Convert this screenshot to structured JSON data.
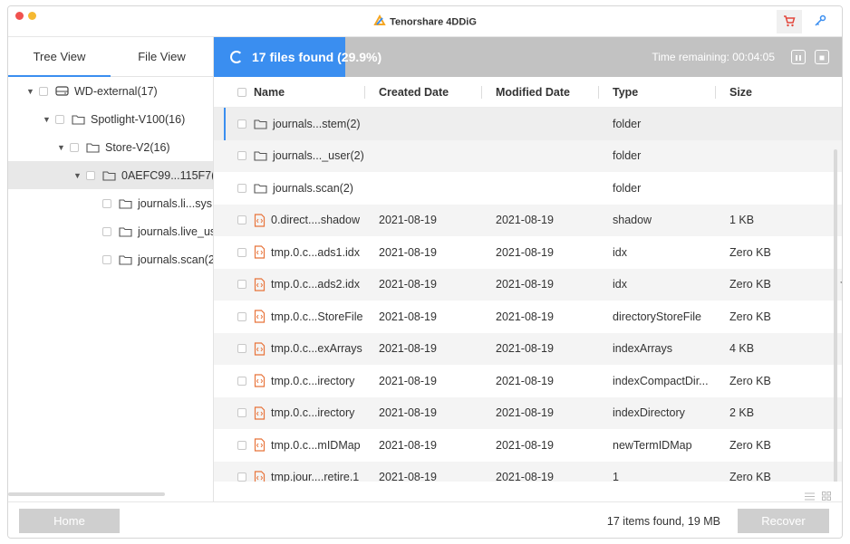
{
  "app": {
    "title": "Tenorshare 4DDiG",
    "accent_color": "#3a8ef0",
    "icons": {
      "cart": "cart-icon",
      "key": "key-icon",
      "logo": "4ddig-logo-icon"
    }
  },
  "left_pane": {
    "tabs": [
      {
        "label": "Tree View",
        "active": true
      },
      {
        "label": "File View",
        "active": false
      }
    ],
    "tree": [
      {
        "label": "WD-external(17)",
        "level": 0,
        "expanded": true,
        "icon": "drive-icon"
      },
      {
        "label": "Spotlight-V100(16)",
        "level": 1,
        "expanded": true,
        "icon": "folder-icon"
      },
      {
        "label": "Store-V2(16)",
        "level": 2,
        "expanded": true,
        "icon": "folder-icon"
      },
      {
        "label": "0AEFC99...115F7(",
        "level": 3,
        "expanded": true,
        "icon": "folder-icon",
        "selected": true
      },
      {
        "label": "journals.li...sys",
        "level": 4,
        "icon": "folder-icon"
      },
      {
        "label": "journals.live_us",
        "level": 4,
        "icon": "folder-icon"
      },
      {
        "label": "journals.scan(2",
        "level": 4,
        "icon": "folder-icon"
      }
    ]
  },
  "scan": {
    "status": "17 files found (29.9%)",
    "progress": 0.299,
    "time_remaining": "Time remaining: 00:04:05",
    "icons": {
      "pause": "pause-icon",
      "stop": "stop-icon",
      "spinner": "spinner-icon"
    }
  },
  "table": {
    "columns": [
      "Name",
      "Created Date",
      "Modified Date",
      "Type",
      "Size"
    ],
    "rows": [
      {
        "name": "journals...stem(2)",
        "created": "",
        "modified": "",
        "type": "folder",
        "size": "",
        "kind": "folder"
      },
      {
        "name": "journals..._user(2)",
        "created": "",
        "modified": "",
        "type": "folder",
        "size": "",
        "kind": "folder"
      },
      {
        "name": "journals.scan(2)",
        "created": "",
        "modified": "",
        "type": "folder",
        "size": "",
        "kind": "folder"
      },
      {
        "name": "0.direct....shadow",
        "created": "2021-08-19",
        "modified": "2021-08-19",
        "type": "shadow",
        "size": "1 KB",
        "kind": "file"
      },
      {
        "name": "tmp.0.c...ads1.idx",
        "created": "2021-08-19",
        "modified": "2021-08-19",
        "type": "idx",
        "size": "Zero KB",
        "kind": "file"
      },
      {
        "name": "tmp.0.c...ads2.idx",
        "created": "2021-08-19",
        "modified": "2021-08-19",
        "type": "idx",
        "size": "Zero KB",
        "kind": "file"
      },
      {
        "name": "tmp.0.c...StoreFile",
        "created": "2021-08-19",
        "modified": "2021-08-19",
        "type": "directoryStoreFile",
        "size": "Zero KB",
        "kind": "file"
      },
      {
        "name": "tmp.0.c...exArrays",
        "created": "2021-08-19",
        "modified": "2021-08-19",
        "type": "indexArrays",
        "size": "4 KB",
        "kind": "file"
      },
      {
        "name": "tmp.0.c...irectory",
        "created": "2021-08-19",
        "modified": "2021-08-19",
        "type": "indexCompactDir...",
        "size": "Zero KB",
        "kind": "file"
      },
      {
        "name": "tmp.0.c...irectory",
        "created": "2021-08-19",
        "modified": "2021-08-19",
        "type": "indexDirectory",
        "size": "2 KB",
        "kind": "file"
      },
      {
        "name": "tmp.0.c...mIDMap",
        "created": "2021-08-19",
        "modified": "2021-08-19",
        "type": "newTermIDMap",
        "size": "Zero KB",
        "kind": "file"
      },
      {
        "name": "tmp.jour....retire.1",
        "created": "2021-08-19",
        "modified": "2021-08-19",
        "type": "1",
        "size": "Zero KB",
        "kind": "file"
      }
    ]
  },
  "bottom": {
    "home_label": "Home",
    "status": "17 items found, 19 MB",
    "recover_label": "Recover"
  }
}
